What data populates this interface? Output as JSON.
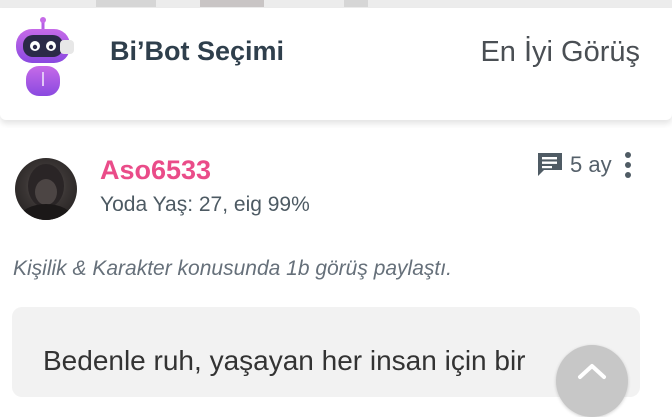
{
  "header": {
    "title": "Bi’Bot Seçimi",
    "sort_label": "En İyi Görüş"
  },
  "post": {
    "username": "Aso6533",
    "user_meta": "Yoda Yaş: 27, eig 99%",
    "time_ago": "5 ay",
    "activity": "Kişilik & Karakter konusunda 1b görüş paylaştı.",
    "quote": "Bedenle ruh, yaşayan her insan için bir"
  },
  "icons": {
    "bot": "robot-avatar-icon",
    "comment": "message-icon",
    "more": "more-vertical-icon",
    "scroll_top": "chevron-up-icon"
  },
  "colors": {
    "username": "#ea4c89",
    "title": "#2f3f4c",
    "quote_bg": "#f2f2f2"
  }
}
